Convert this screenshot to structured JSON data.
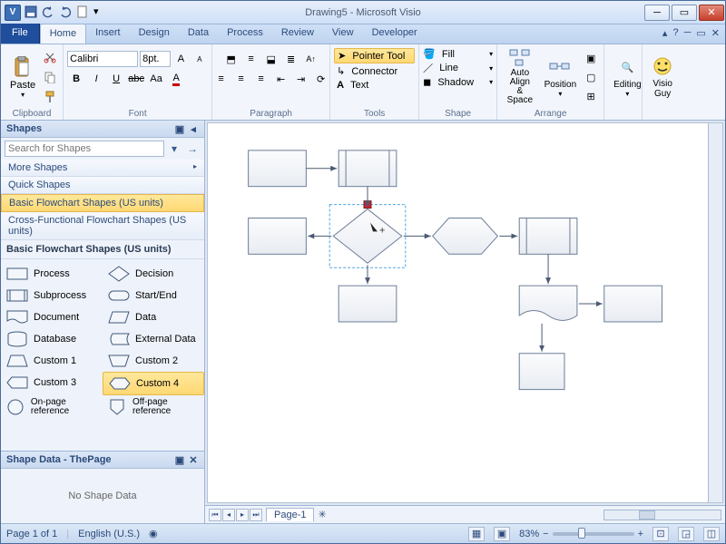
{
  "titlebar": {
    "app_glyph": "V",
    "document_title": "Drawing5 - Microsoft Visio"
  },
  "ribbon_tabs": {
    "file": "File",
    "tabs": [
      "Home",
      "Insert",
      "Design",
      "Data",
      "Process",
      "Review",
      "View",
      "Developer"
    ],
    "active": "Home",
    "help": "?"
  },
  "ribbon": {
    "clipboard": {
      "paste": "Paste",
      "label": "Clipboard"
    },
    "font": {
      "font_name": "Calibri",
      "font_size": "8pt.",
      "label": "Font"
    },
    "paragraph": {
      "label": "Paragraph"
    },
    "tools": {
      "pointer": "Pointer Tool",
      "connector": "Connector",
      "text": "Text",
      "label": "Tools"
    },
    "shape": {
      "fill": "Fill",
      "line": "Line",
      "shadow": "Shadow",
      "label": "Shape"
    },
    "arrange": {
      "autoalign": "Auto Align & Space",
      "position": "Position",
      "label": "Arrange"
    },
    "editing": {
      "label": "Editing"
    },
    "visioguy": {
      "label": "Visio Guy"
    }
  },
  "shapes_panel": {
    "title": "Shapes",
    "search_placeholder": "Search for Shapes",
    "more": "More Shapes",
    "quick": "Quick Shapes",
    "stencils": [
      {
        "name": "Basic Flowchart Shapes (US units)",
        "active": true
      },
      {
        "name": "Cross-Functional Flowchart Shapes (US units)",
        "active": false
      }
    ],
    "stencil_title": "Basic Flowchart Shapes (US units)",
    "shapes": [
      {
        "name": "Process"
      },
      {
        "name": "Decision"
      },
      {
        "name": "Subprocess"
      },
      {
        "name": "Start/End"
      },
      {
        "name": "Document"
      },
      {
        "name": "Data"
      },
      {
        "name": "Database"
      },
      {
        "name": "External Data"
      },
      {
        "name": "Custom 1"
      },
      {
        "name": "Custom 2"
      },
      {
        "name": "Custom 3"
      },
      {
        "name": "Custom 4",
        "selected": true
      },
      {
        "name": "On-page reference"
      },
      {
        "name": "Off-page reference"
      }
    ]
  },
  "shape_data": {
    "title": "Shape Data - ThePage",
    "empty": "No Shape Data"
  },
  "pagebar": {
    "page": "Page-1"
  },
  "status": {
    "page": "Page 1 of 1",
    "lang": "English (U.S.)",
    "zoom": "83%"
  }
}
